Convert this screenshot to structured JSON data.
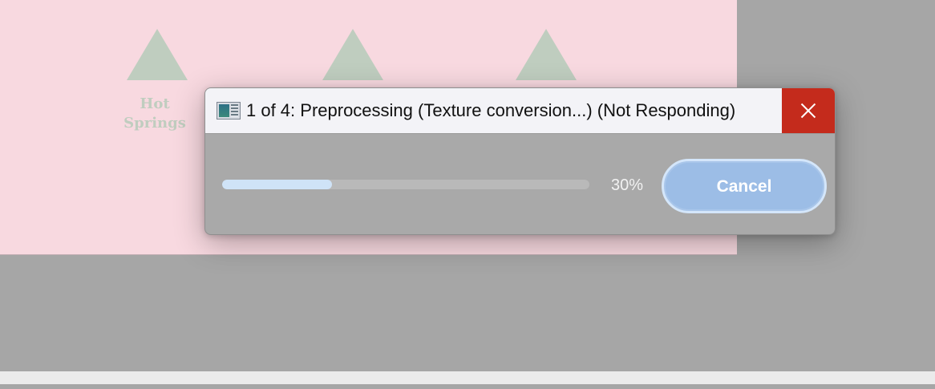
{
  "background": {
    "document_logo_text": "Hot\nSprings"
  },
  "dialog": {
    "title": "1 of 4: Preprocessing (Texture conversion...) (Not Responding)",
    "app_icon": "app-window-icon",
    "close_icon": "close-icon",
    "progress": {
      "fraction": 0.3,
      "label": "30%"
    },
    "cancel_label": "Cancel"
  },
  "colors": {
    "close_button": "#c42b1c",
    "progress_fill": "#cfe3f7",
    "cancel_button": "#9cbde6",
    "canvas_background": "#f8d9e0"
  }
}
